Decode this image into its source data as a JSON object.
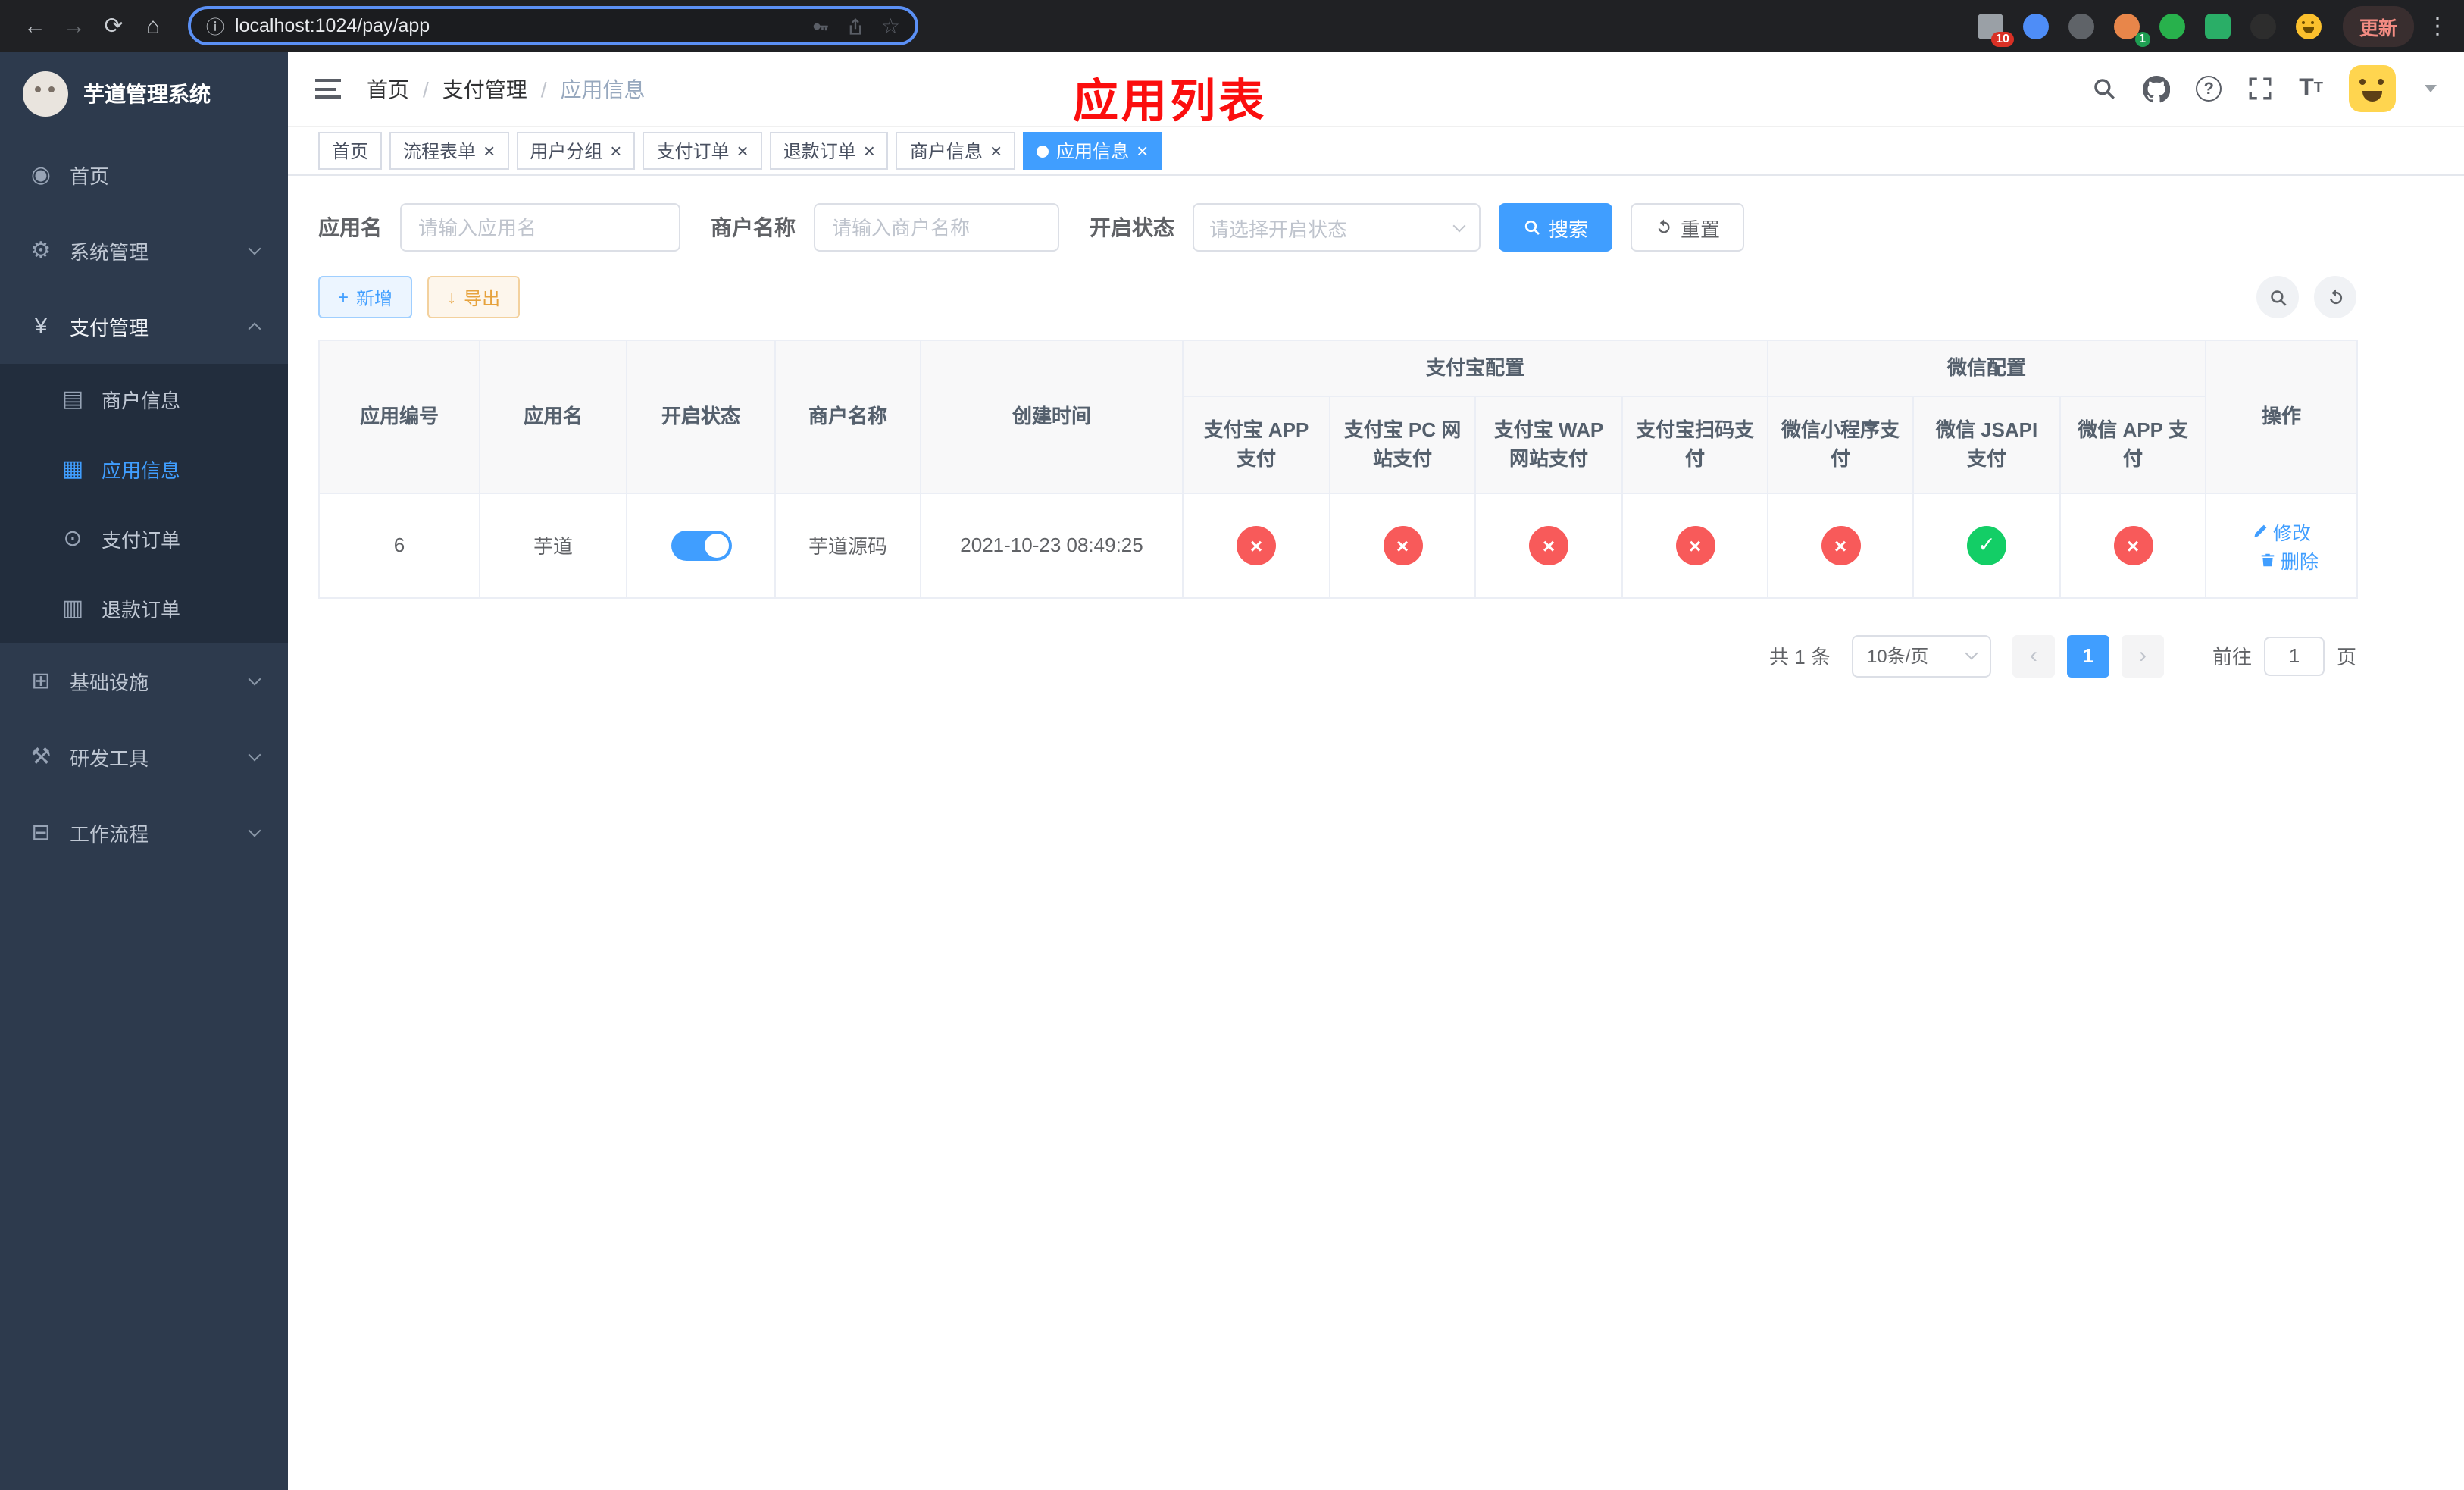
{
  "colors": {
    "primary": "#409eff",
    "success": "#13ce66",
    "danger": "#f85a5a",
    "warning": "#e6a23c",
    "annotation_red": "#ff0000"
  },
  "browser": {
    "url": "localhost:1024/pay/app",
    "update_label": "更新",
    "extensions_badge": "10",
    "profile_badge": "1"
  },
  "sidebar": {
    "title": "芋道管理系统",
    "items": [
      {
        "label": "首页",
        "icon": "dashboard-icon"
      },
      {
        "label": "系统管理",
        "icon": "gear-icon"
      },
      {
        "label": "支付管理",
        "icon": "yen-icon"
      },
      {
        "label": "商户信息",
        "icon": "merchant-card-icon"
      },
      {
        "label": "应用信息",
        "icon": "app-grid-icon"
      },
      {
        "label": "支付订单",
        "icon": "pay-order-icon"
      },
      {
        "label": "退款订单",
        "icon": "refund-order-icon"
      },
      {
        "label": "基础设施",
        "icon": "infra-icon"
      },
      {
        "label": "研发工具",
        "icon": "devtools-icon"
      },
      {
        "label": "工作流程",
        "icon": "workflow-icon"
      }
    ]
  },
  "header": {
    "breadcrumb": [
      "首页",
      "支付管理",
      "应用信息"
    ],
    "separator": "/",
    "page_title": "应用列表"
  },
  "tabs": [
    {
      "label": "首页",
      "closable": false,
      "active": false
    },
    {
      "label": "流程表单",
      "closable": true,
      "active": false
    },
    {
      "label": "用户分组",
      "closable": true,
      "active": false
    },
    {
      "label": "支付订单",
      "closable": true,
      "active": false
    },
    {
      "label": "退款订单",
      "closable": true,
      "active": false
    },
    {
      "label": "商户信息",
      "closable": true,
      "active": false
    },
    {
      "label": "应用信息",
      "closable": true,
      "active": true
    }
  ],
  "filters": {
    "app_name_label": "应用名",
    "app_name_placeholder": "请输入应用名",
    "merchant_label": "商户名称",
    "merchant_placeholder": "请输入商户名称",
    "status_label": "开启状态",
    "status_placeholder": "请选择开启状态",
    "search_label": "搜索",
    "reset_label": "重置"
  },
  "toolbar": {
    "add_label": "新增",
    "export_label": "导出"
  },
  "table": {
    "headers": {
      "id": "应用编号",
      "name": "应用名",
      "status": "开启状态",
      "merchant": "商户名称",
      "created": "创建时间",
      "alipay_group": "支付宝配置",
      "wechat_group": "微信配置",
      "actions": "操作",
      "alipay_cols": [
        "支付宝 APP 支付",
        "支付宝 PC 网站支付",
        "支付宝 WAP 网站支付",
        "支付宝扫码支付"
      ],
      "wechat_cols": [
        "微信小程序支付",
        "微信 JSAPI 支付",
        "微信 APP 支付"
      ]
    },
    "row": {
      "id": "6",
      "name": "芋道",
      "enabled": true,
      "merchant": "芋道源码",
      "created": "2021-10-23 08:49:25",
      "configs": [
        "no",
        "no",
        "no",
        "no",
        "no",
        "yes",
        "no"
      ],
      "edit_label": "修改",
      "delete_label": "删除"
    }
  },
  "pagination": {
    "total": "共 1 条",
    "page_size": "10条/页",
    "current_page": "1",
    "goto_label": "前往",
    "goto_value": "1",
    "goto_suffix": "页"
  }
}
